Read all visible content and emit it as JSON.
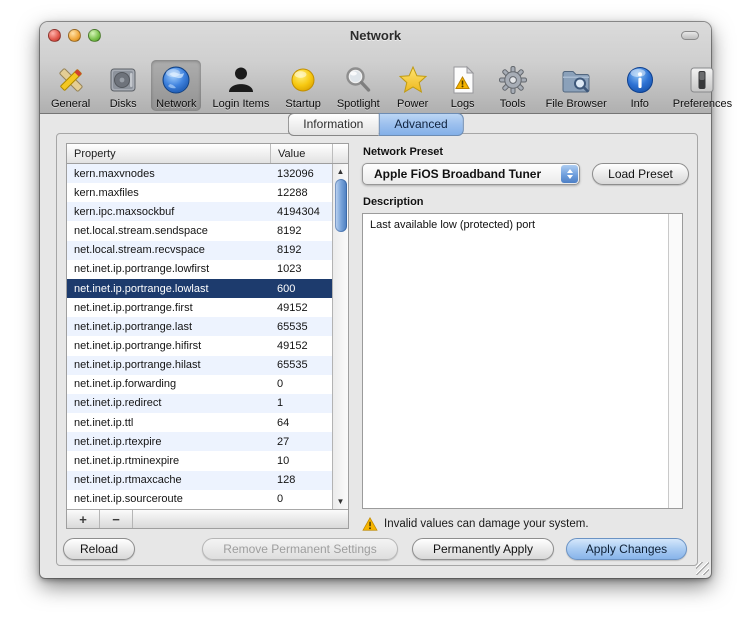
{
  "window": {
    "title": "Network"
  },
  "toolbar": {
    "items": [
      {
        "label": "General",
        "icon": "pencil-ruler-icon",
        "selected": false
      },
      {
        "label": "Disks",
        "icon": "hard-drive-icon",
        "selected": false
      },
      {
        "label": "Network",
        "icon": "globe-icon",
        "selected": true
      },
      {
        "label": "Login Items",
        "icon": "person-icon",
        "selected": false
      },
      {
        "label": "Startup",
        "icon": "yellow-orb-icon",
        "selected": false
      },
      {
        "label": "Spotlight",
        "icon": "magnifier-icon",
        "selected": false
      },
      {
        "label": "Power",
        "icon": "star-icon",
        "selected": false
      },
      {
        "label": "Logs",
        "icon": "log-document-icon",
        "selected": false
      },
      {
        "label": "Tools",
        "icon": "gear-icon",
        "selected": false
      },
      {
        "label": "File Browser",
        "icon": "folder-search-icon",
        "selected": false
      },
      {
        "label": "Info",
        "icon": "info-icon",
        "selected": false
      },
      {
        "label": "Preferences",
        "icon": "switch-icon",
        "selected": false
      }
    ]
  },
  "tabs": [
    {
      "label": "Information",
      "active": false
    },
    {
      "label": "Advanced",
      "active": true
    }
  ],
  "table": {
    "columns": {
      "property": "Property",
      "value": "Value"
    },
    "selected_property": "net.inet.ip.portrange.lowlast",
    "add_button": "+",
    "remove_button": "−",
    "rows": [
      {
        "property": "kern.maxvnodes",
        "value": "132096"
      },
      {
        "property": "kern.maxfiles",
        "value": "12288"
      },
      {
        "property": "kern.ipc.maxsockbuf",
        "value": "4194304"
      },
      {
        "property": "net.local.stream.sendspace",
        "value": "8192"
      },
      {
        "property": "net.local.stream.recvspace",
        "value": "8192"
      },
      {
        "property": "net.inet.ip.portrange.lowfirst",
        "value": "1023"
      },
      {
        "property": "net.inet.ip.portrange.lowlast",
        "value": "600"
      },
      {
        "property": "net.inet.ip.portrange.first",
        "value": "49152"
      },
      {
        "property": "net.inet.ip.portrange.last",
        "value": "65535"
      },
      {
        "property": "net.inet.ip.portrange.hifirst",
        "value": "49152"
      },
      {
        "property": "net.inet.ip.portrange.hilast",
        "value": "65535"
      },
      {
        "property": "net.inet.ip.forwarding",
        "value": "0"
      },
      {
        "property": "net.inet.ip.redirect",
        "value": "1"
      },
      {
        "property": "net.inet.ip.ttl",
        "value": "64"
      },
      {
        "property": "net.inet.ip.rtexpire",
        "value": "27"
      },
      {
        "property": "net.inet.ip.rtminexpire",
        "value": "10"
      },
      {
        "property": "net.inet.ip.rtmaxcache",
        "value": "128"
      },
      {
        "property": "net.inet.ip.sourceroute",
        "value": "0"
      }
    ]
  },
  "preset_panel": {
    "preset_label": "Network Preset",
    "preset_value": "Apple FiOS Broadband Tuner",
    "load_preset_button": "Load Preset",
    "description_label": "Description",
    "description_text": "Last available low (protected) port",
    "warning_text": "Invalid values can damage your system."
  },
  "footer_buttons": {
    "reload": "Reload",
    "remove_permanent": "Remove Permanent Settings",
    "permanently_apply": "Permanently Apply",
    "apply_changes": "Apply Changes"
  },
  "colors": {
    "selected_row_bg": "#1d3b6d",
    "row_stripe_blue": "#edf3fe",
    "active_tab_blue": "#9cc0ee",
    "default_button_blue": "#a9cbf2",
    "scrollbar_aqua_blue": "#79a4da",
    "warning_yellow": "#f7b500",
    "chrome_gray": "#cfcfcf",
    "content_gray": "#e7e7e7"
  }
}
